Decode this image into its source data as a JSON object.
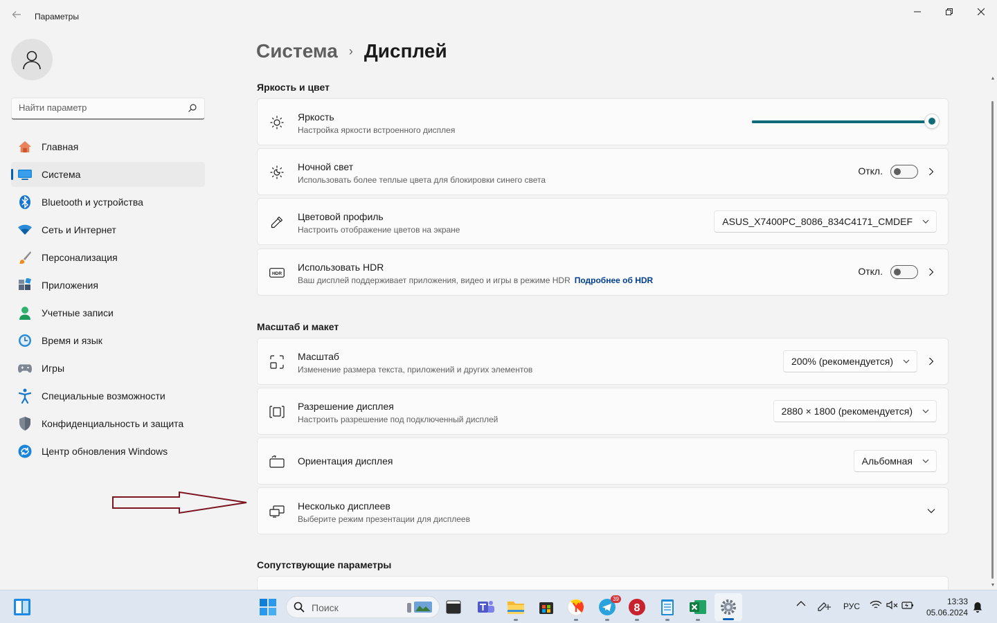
{
  "window": {
    "title": "Параметры",
    "back_icon": "back-arrow-icon"
  },
  "sidebar": {
    "search_placeholder": "Найти параметр",
    "items": [
      {
        "label": "Главная",
        "icon": "home-icon"
      },
      {
        "label": "Система",
        "icon": "system-display-icon",
        "active": true
      },
      {
        "label": "Bluetooth и устройства",
        "icon": "bluetooth-icon"
      },
      {
        "label": "Сеть и Интернет",
        "icon": "wifi-icon"
      },
      {
        "label": "Персонализация",
        "icon": "brush-icon"
      },
      {
        "label": "Приложения",
        "icon": "apps-icon"
      },
      {
        "label": "Учетные записи",
        "icon": "account-icon"
      },
      {
        "label": "Время и язык",
        "icon": "time-language-icon"
      },
      {
        "label": "Игры",
        "icon": "gamepad-icon"
      },
      {
        "label": "Специальные возможности",
        "icon": "accessibility-icon"
      },
      {
        "label": "Конфиденциальность и защита",
        "icon": "shield-icon"
      },
      {
        "label": "Центр обновления Windows",
        "icon": "update-icon"
      }
    ]
  },
  "breadcrumb": {
    "parent": "Система",
    "separator": "›",
    "current": "Дисплей"
  },
  "sections": {
    "brightness_color": "Яркость и цвет",
    "scale_layout": "Масштаб и макет",
    "related": "Сопутствующие параметры"
  },
  "cards": {
    "brightness": {
      "title": "Яркость",
      "desc": "Настройка яркости встроенного дисплея",
      "value": 1.0
    },
    "night_light": {
      "title": "Ночной свет",
      "desc": "Использовать более теплые цвета для блокировки синего света",
      "state": "Откл."
    },
    "color_profile": {
      "title": "Цветовой профиль",
      "desc": "Настроить отображение цветов на экране",
      "selected": "ASUS_X7400PC_8086_834C4171_CMDEF"
    },
    "hdr": {
      "title": "Использовать HDR",
      "desc": "Ваш дисплей поддерживает приложения, видео и игры в режиме HDR",
      "link": "Подробнее об HDR",
      "state": "Откл."
    },
    "scale": {
      "title": "Масштаб",
      "desc": "Изменение размера текста, приложений и других элементов",
      "selected": "200% (рекомендуется)"
    },
    "resolution": {
      "title": "Разрешение дисплея",
      "desc": "Настроить разрешение под подключенный дисплей",
      "selected": "2880 × 1800 (рекомендуется)"
    },
    "orientation": {
      "title": "Ориентация дисплея",
      "selected": "Альбомная"
    },
    "multiple": {
      "title": "Несколько дисплеев",
      "desc": "Выберите режим презентации для дисплеев"
    }
  },
  "taskbar": {
    "search_placeholder": "Поиск",
    "telegram_badge": "39",
    "language": "РУС",
    "time": "13:33",
    "date": "05.06.2024"
  },
  "colors": {
    "accent": "#0f6b78",
    "link": "#003e92",
    "annotation_arrow": "#7a1420"
  }
}
